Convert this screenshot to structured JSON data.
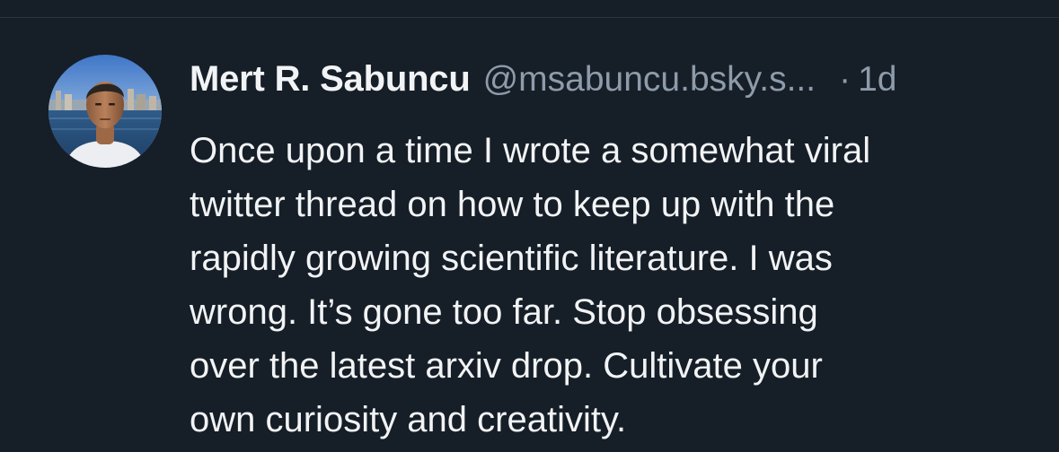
{
  "post": {
    "author": {
      "display_name": "Mert R. Sabuncu",
      "handle": "@msabuncu.bsky.s...",
      "avatar_icon": "profile-photo"
    },
    "separator": "·",
    "time": "1d",
    "text_lines": [
      "Once upon a time I wrote a somewhat viral",
      "twitter thread on how to keep up with the",
      "rapidly growing scientific literature. I was",
      "wrong. It’s gone too far. Stop obsessing",
      "over the latest arxiv drop. Cultivate your",
      "own curiosity and creativity."
    ]
  },
  "colors": {
    "background": "#161e27",
    "primary_text": "#f1f3f5",
    "secondary_text": "#8d9bab",
    "divider": "#2a3441"
  }
}
